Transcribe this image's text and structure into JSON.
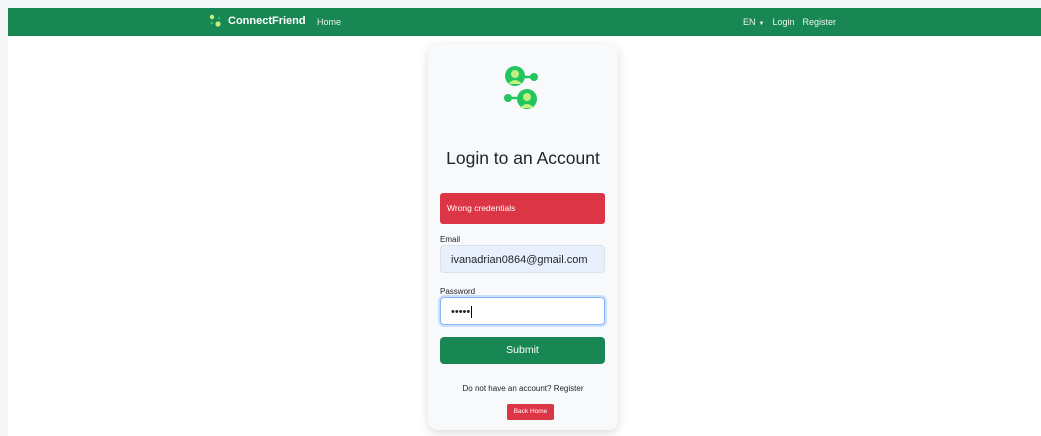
{
  "navbar": {
    "brand_name": "ConnectFriend",
    "home_label": "Home",
    "language": "EN",
    "login_label": "Login",
    "register_label": "Register"
  },
  "login_card": {
    "title": "Login to an Account",
    "alert_text": "Wrong credentials",
    "email_label": "Email",
    "email_value": "ivanadrian0864@gmail.com",
    "password_label": "Password",
    "password_masked": "•••••",
    "submit_label": "Submit",
    "no_account_text": "Do not have an account? Register",
    "back_home_label": "Back Home"
  },
  "colors": {
    "brand_green": "#198754",
    "danger_red": "#dc3545",
    "logo_light": "#c5ef7e",
    "logo_dark": "#22c55e"
  },
  "icons": {
    "brand": "connectfriend-logo-icon",
    "caret": "caret-down-icon"
  }
}
